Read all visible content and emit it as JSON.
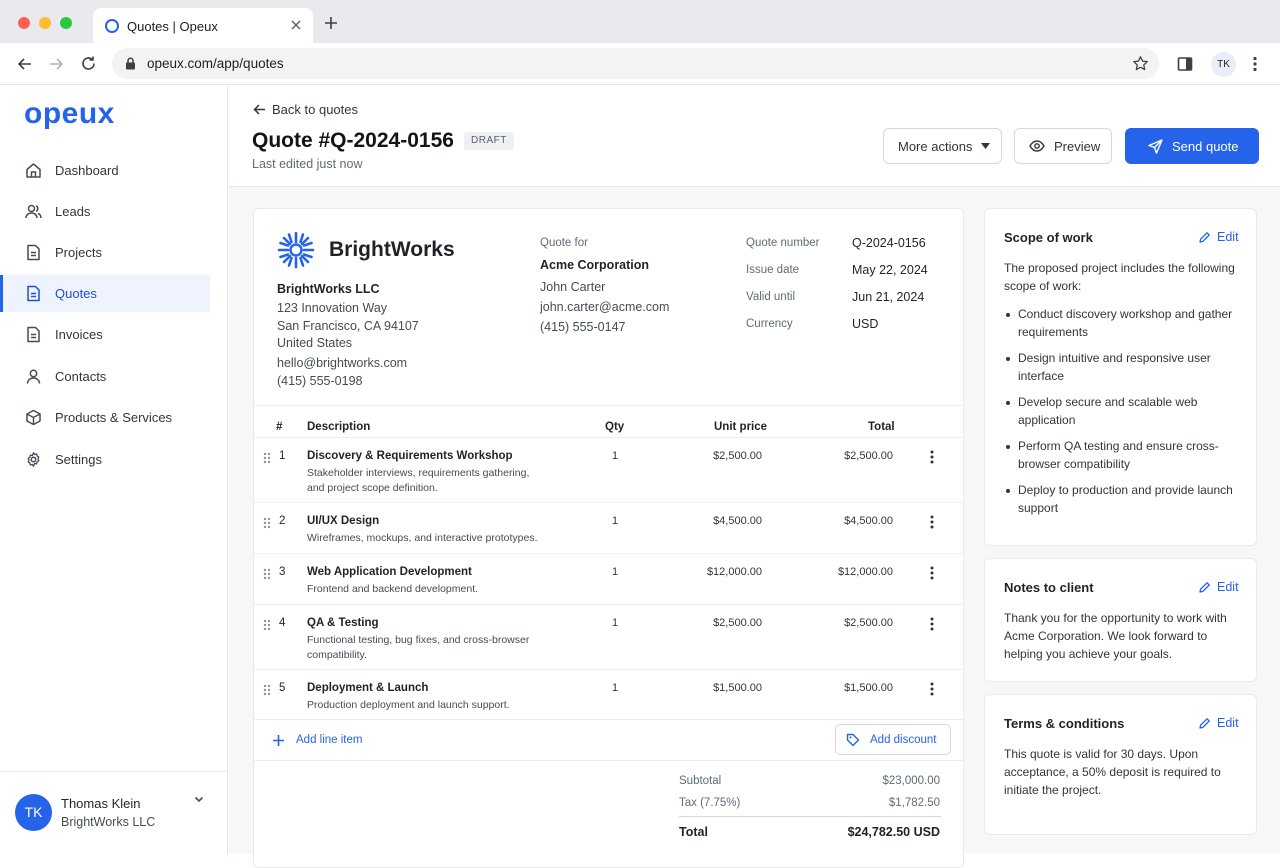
{
  "browser": {
    "tab_title": "Quotes | Opeux",
    "url": "opeux.com/app/quotes",
    "profile_initials": "TK"
  },
  "app": {
    "logo": "opeux",
    "accent_color": "#2563eb"
  },
  "sidebar": {
    "items": [
      {
        "label": "Dashboard",
        "icon": "home-icon",
        "active": false
      },
      {
        "label": "Leads",
        "icon": "users-icon",
        "active": false
      },
      {
        "label": "Projects",
        "icon": "document-icon",
        "active": false
      },
      {
        "label": "Quotes",
        "icon": "document-icon",
        "active": true
      },
      {
        "label": "Invoices",
        "icon": "document-icon",
        "active": false
      },
      {
        "label": "Contacts",
        "icon": "user-icon",
        "active": false
      },
      {
        "label": "Products & Services",
        "icon": "box-icon",
        "active": false
      },
      {
        "label": "Settings",
        "icon": "gear-icon",
        "active": false
      }
    ],
    "user": {
      "initials": "TK",
      "name": "Thomas Klein",
      "org": "BrightWorks LLC"
    }
  },
  "header": {
    "back_label": "Back to quotes",
    "title": "Quote #Q-2024-0156",
    "status": "DRAFT",
    "edited": "Last edited just now",
    "more_actions": "More actions",
    "preview": "Preview",
    "send": "Send quote"
  },
  "company": {
    "brand": "BrightWorks",
    "legal_name": "BrightWorks LLC",
    "address_1": "123 Innovation Way",
    "address_2": "San Francisco, CA 94107",
    "country": "United States",
    "email": "hello@brightworks.com",
    "phone": "(415) 555-0198"
  },
  "client": {
    "label": "Quote for",
    "company": "Acme Corporation",
    "contact": "John Carter",
    "email": "john.carter@acme.com",
    "phone": "(415) 555-0147"
  },
  "meta": {
    "number_label": "Quote number",
    "number": "Q-2024-0156",
    "issue_label": "Issue date",
    "issue": "May 22, 2024",
    "valid_label": "Valid until",
    "valid": "Jun 21, 2024",
    "currency_label": "Currency",
    "currency": "USD"
  },
  "table": {
    "headers": {
      "num": "#",
      "description": "Description",
      "qty": "Qty",
      "unit_price": "Unit price",
      "total": "Total"
    },
    "rows": [
      {
        "num": "1",
        "title": "Discovery & Requirements Workshop",
        "desc": "Stakeholder interviews, requirements gathering, and project scope definition.",
        "qty": "1",
        "unit": "$2,500.00",
        "total": "$2,500.00"
      },
      {
        "num": "2",
        "title": "UI/UX Design",
        "desc": "Wireframes, mockups, and interactive prototypes.",
        "qty": "1",
        "unit": "$4,500.00",
        "total": "$4,500.00"
      },
      {
        "num": "3",
        "title": "Web Application Development",
        "desc": "Frontend and backend development.",
        "qty": "1",
        "unit": "$12,000.00",
        "total": "$12,000.00"
      },
      {
        "num": "4",
        "title": "QA & Testing",
        "desc": "Functional testing, bug fixes, and cross-browser compatibility.",
        "qty": "1",
        "unit": "$2,500.00",
        "total": "$2,500.00"
      },
      {
        "num": "5",
        "title": "Deployment & Launch",
        "desc": "Production deployment and launch support.",
        "qty": "1",
        "unit": "$1,500.00",
        "total": "$1,500.00"
      }
    ],
    "add_line_item": "Add line item",
    "add_discount": "Add discount"
  },
  "totals": {
    "subtotal_label": "Subtotal",
    "subtotal": "$23,000.00",
    "tax_label": "Tax (7.75%)",
    "tax": "$1,782.50",
    "total_label": "Total",
    "total": "$24,782.50 USD"
  },
  "scope": {
    "title": "Scope of work",
    "edit": "Edit",
    "intro": "The proposed project includes the following scope of work:",
    "items": [
      "Conduct discovery workshop and gather requirements",
      "Design intuitive and responsive user interface",
      "Develop secure and scalable web application",
      "Perform QA testing and ensure cross-browser compatibility",
      "Deploy to production and provide launch support"
    ]
  },
  "notes": {
    "title": "Notes to client",
    "edit": "Edit",
    "body": "Thank you for the opportunity to work with Acme Corporation. We look forward to helping you achieve your goals."
  },
  "terms": {
    "title": "Terms & conditions",
    "edit": "Edit",
    "body": "This quote is valid for 30 days. Upon acceptance, a 50% deposit is required to initiate the project."
  }
}
